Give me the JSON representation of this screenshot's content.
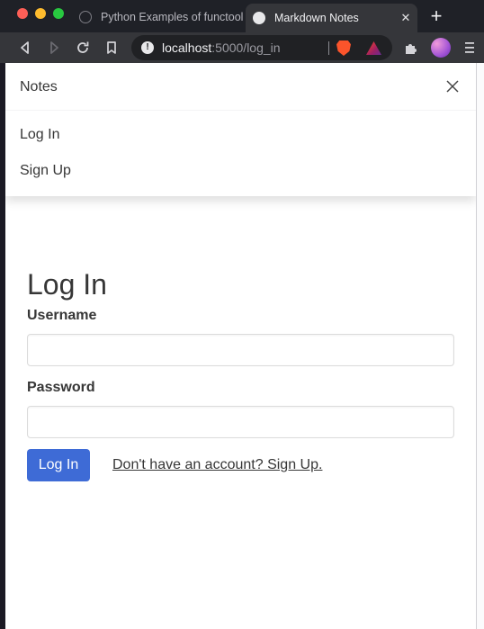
{
  "browser": {
    "tabs": [
      {
        "title": "Python Examples of functools",
        "active": false
      },
      {
        "title": "Markdown Notes",
        "active": true
      }
    ],
    "tab_close": "✕",
    "new_tab": "+",
    "address": {
      "host": "localhost",
      "path": ":5000/log_in",
      "info": "!"
    }
  },
  "navbar": {
    "brand": "Notes",
    "links": [
      "Log In",
      "Sign Up"
    ]
  },
  "form": {
    "title": "Log In",
    "username_label": "Username",
    "username_value": "",
    "password_label": "Password",
    "password_value": "",
    "submit_label": "Log In",
    "signup_link": "Don't have an account? Sign Up."
  },
  "colors": {
    "primary_button": "#3e6bd6",
    "text": "#363636"
  }
}
